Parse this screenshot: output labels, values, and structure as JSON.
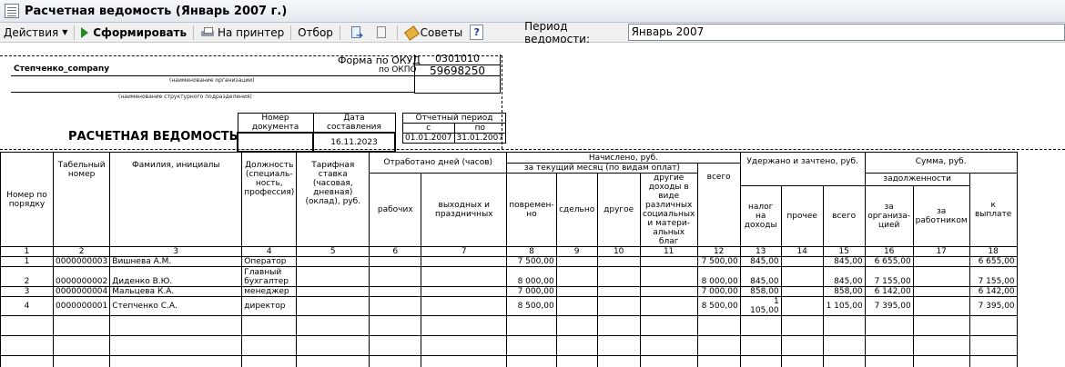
{
  "window": {
    "title": "Расчетная ведомость (Январь 2007 г.)"
  },
  "toolbar": {
    "actions_label": "Действия",
    "generate_label": "Сформировать",
    "print_label": "На принтер",
    "filter_label": "Отбор",
    "tips_label": "Советы",
    "help_label": "?",
    "period_label": "Период ведомости:",
    "period_value": "Январь 2007"
  },
  "report": {
    "form_okud_label": "Форма по ОКУД",
    "form_okud_value": "0301010",
    "okpo_label": "по ОКПО",
    "okpo_value": "59698250",
    "organization": "Степченко_company",
    "org_caption": "(наименование организации)",
    "division_caption": "(наименование структурного подразделения)",
    "doc_number_label": "Номер документа",
    "doc_date_label": "Дата составления",
    "doc_date_value": "16.11.2023",
    "period_header": "Отчетный период",
    "period_from_label": "с",
    "period_to_label": "по",
    "period_from": "01.01.2007",
    "period_to": "31.01.2007",
    "title": "РАСЧЕТНАЯ ВЕДОМОСТЬ"
  },
  "columns": {
    "num": "Номер по порядку",
    "tab": "Табельный номер",
    "name": "Фамилия, инициалы",
    "position": "Должность (специаль-ность, профессия)",
    "rate": "Тарифная ставка (часовая, дневная) (оклад), руб.",
    "worked": "Отработано дней (часов)",
    "worked_work": "рабочих",
    "worked_holidays": "выходных и праздничных",
    "accrued": "Начислено, руб.",
    "accrued_current": "за текущий месяц (по видам оплат)",
    "time_based": "повремен-но",
    "piece": "сдельно",
    "other": "другое",
    "other_income": "другие доходы в виде различных социальных и матери-альных благ",
    "total": "всего",
    "withheld": "Удержано и зачтено, руб.",
    "income_tax": "налог на доходы",
    "other_withheld": "прочее",
    "withheld_total": "всего",
    "amount": "Сумма, руб.",
    "debt": "задолженности",
    "org_debt": "за организа-цией",
    "emp_debt": "за работником",
    "to_pay": "к выплате"
  },
  "column_numbers": [
    "1",
    "2",
    "3",
    "4",
    "5",
    "6",
    "7",
    "8",
    "9",
    "10",
    "11",
    "12",
    "13",
    "14",
    "15",
    "16",
    "17",
    "18"
  ],
  "rows": [
    {
      "n": "1",
      "tab": "0000000003",
      "name": "Вишнева А.М.",
      "pos": "Оператор",
      "pos2": "",
      "time": "7 500,00",
      "total": "7 500,00",
      "tax": "845,00",
      "wtotal": "845,00",
      "org": "6 655,00",
      "pay": "6 655,00"
    },
    {
      "n": "2",
      "tab": "0000000002",
      "name": "Диденко В.Ю.",
      "pos": "Главный",
      "pos2": "бухгалтер",
      "time": "8 000,00",
      "total": "8 000,00",
      "tax": "845,00",
      "wtotal": "845,00",
      "org": "7 155,00",
      "pay": "7 155,00"
    },
    {
      "n": "3",
      "tab": "0000000004",
      "name": "Мальцева К.А.",
      "pos": "менеджер",
      "pos2": "",
      "time": "7 000,00",
      "total": "7 000,00",
      "tax": "858,00",
      "wtotal": "858,00",
      "org": "6 142,00",
      "pay": "6 142,00"
    },
    {
      "n": "4",
      "tab": "0000000001",
      "name": "Степченко С.А.",
      "pos": "директор",
      "pos2": "",
      "time": "8 500,00",
      "total": "8 500,00",
      "tax": "1 105,00",
      "wtotal": "1 105,00",
      "org": "7 395,00",
      "pay": "7 395,00"
    }
  ]
}
